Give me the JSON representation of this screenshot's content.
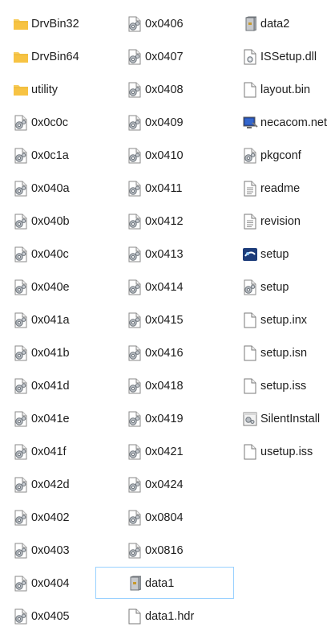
{
  "files": {
    "col0": [
      {
        "name": "DrvBin32",
        "icon": "folder-icon"
      },
      {
        "name": "DrvBin64",
        "icon": "folder-icon"
      },
      {
        "name": "utility",
        "icon": "folder-icon"
      },
      {
        "name": "0x0c0c",
        "icon": "settings-file-icon"
      },
      {
        "name": "0x0c1a",
        "icon": "settings-file-icon"
      },
      {
        "name": "0x040a",
        "icon": "settings-file-icon"
      },
      {
        "name": "0x040b",
        "icon": "settings-file-icon"
      },
      {
        "name": "0x040c",
        "icon": "settings-file-icon"
      },
      {
        "name": "0x040e",
        "icon": "settings-file-icon"
      },
      {
        "name": "0x041a",
        "icon": "settings-file-icon"
      },
      {
        "name": "0x041b",
        "icon": "settings-file-icon"
      },
      {
        "name": "0x041d",
        "icon": "settings-file-icon"
      },
      {
        "name": "0x041e",
        "icon": "settings-file-icon"
      },
      {
        "name": "0x041f",
        "icon": "settings-file-icon"
      },
      {
        "name": "0x042d",
        "icon": "settings-file-icon"
      },
      {
        "name": "0x0402",
        "icon": "settings-file-icon"
      },
      {
        "name": "0x0403",
        "icon": "settings-file-icon"
      },
      {
        "name": "0x0404",
        "icon": "settings-file-icon"
      },
      {
        "name": "0x0405",
        "icon": "settings-file-icon"
      }
    ],
    "col1": [
      {
        "name": "0x0406",
        "icon": "settings-file-icon"
      },
      {
        "name": "0x0407",
        "icon": "settings-file-icon"
      },
      {
        "name": "0x0408",
        "icon": "settings-file-icon"
      },
      {
        "name": "0x0409",
        "icon": "settings-file-icon"
      },
      {
        "name": "0x0410",
        "icon": "settings-file-icon"
      },
      {
        "name": "0x0411",
        "icon": "settings-file-icon"
      },
      {
        "name": "0x0412",
        "icon": "settings-file-icon"
      },
      {
        "name": "0x0413",
        "icon": "settings-file-icon"
      },
      {
        "name": "0x0414",
        "icon": "settings-file-icon"
      },
      {
        "name": "0x0415",
        "icon": "settings-file-icon"
      },
      {
        "name": "0x0416",
        "icon": "settings-file-icon"
      },
      {
        "name": "0x0418",
        "icon": "settings-file-icon"
      },
      {
        "name": "0x0419",
        "icon": "settings-file-icon"
      },
      {
        "name": "0x0421",
        "icon": "settings-file-icon"
      },
      {
        "name": "0x0424",
        "icon": "settings-file-icon"
      },
      {
        "name": "0x0804",
        "icon": "settings-file-icon"
      },
      {
        "name": "0x0816",
        "icon": "settings-file-icon"
      },
      {
        "name": "data1",
        "icon": "cabinet-file-icon",
        "selected": true
      },
      {
        "name": "data1.hdr",
        "icon": "blank-file-icon"
      }
    ],
    "col2": [
      {
        "name": "data2",
        "icon": "cabinet-file-icon"
      },
      {
        "name": "ISSetup.dll",
        "icon": "dll-file-icon"
      },
      {
        "name": "layout.bin",
        "icon": "blank-file-icon"
      },
      {
        "name": "necacom.net",
        "icon": "network-app-icon"
      },
      {
        "name": "pkgconf",
        "icon": "settings-file-icon"
      },
      {
        "name": "readme",
        "icon": "text-file-icon"
      },
      {
        "name": "revision",
        "icon": "text-file-icon"
      },
      {
        "name": "setup",
        "icon": "setup-app-icon"
      },
      {
        "name": "setup",
        "icon": "settings-file-icon"
      },
      {
        "name": "setup.inx",
        "icon": "blank-file-icon"
      },
      {
        "name": "setup.isn",
        "icon": "blank-file-icon"
      },
      {
        "name": "setup.iss",
        "icon": "blank-file-icon"
      },
      {
        "name": "SilentInstall",
        "icon": "batch-file-icon"
      },
      {
        "name": "usetup.iss",
        "icon": "blank-file-icon"
      }
    ]
  },
  "colors": {
    "folder": "#f8cc5a",
    "selection_border": "#99d1ff",
    "text": "#1e1e1e"
  }
}
